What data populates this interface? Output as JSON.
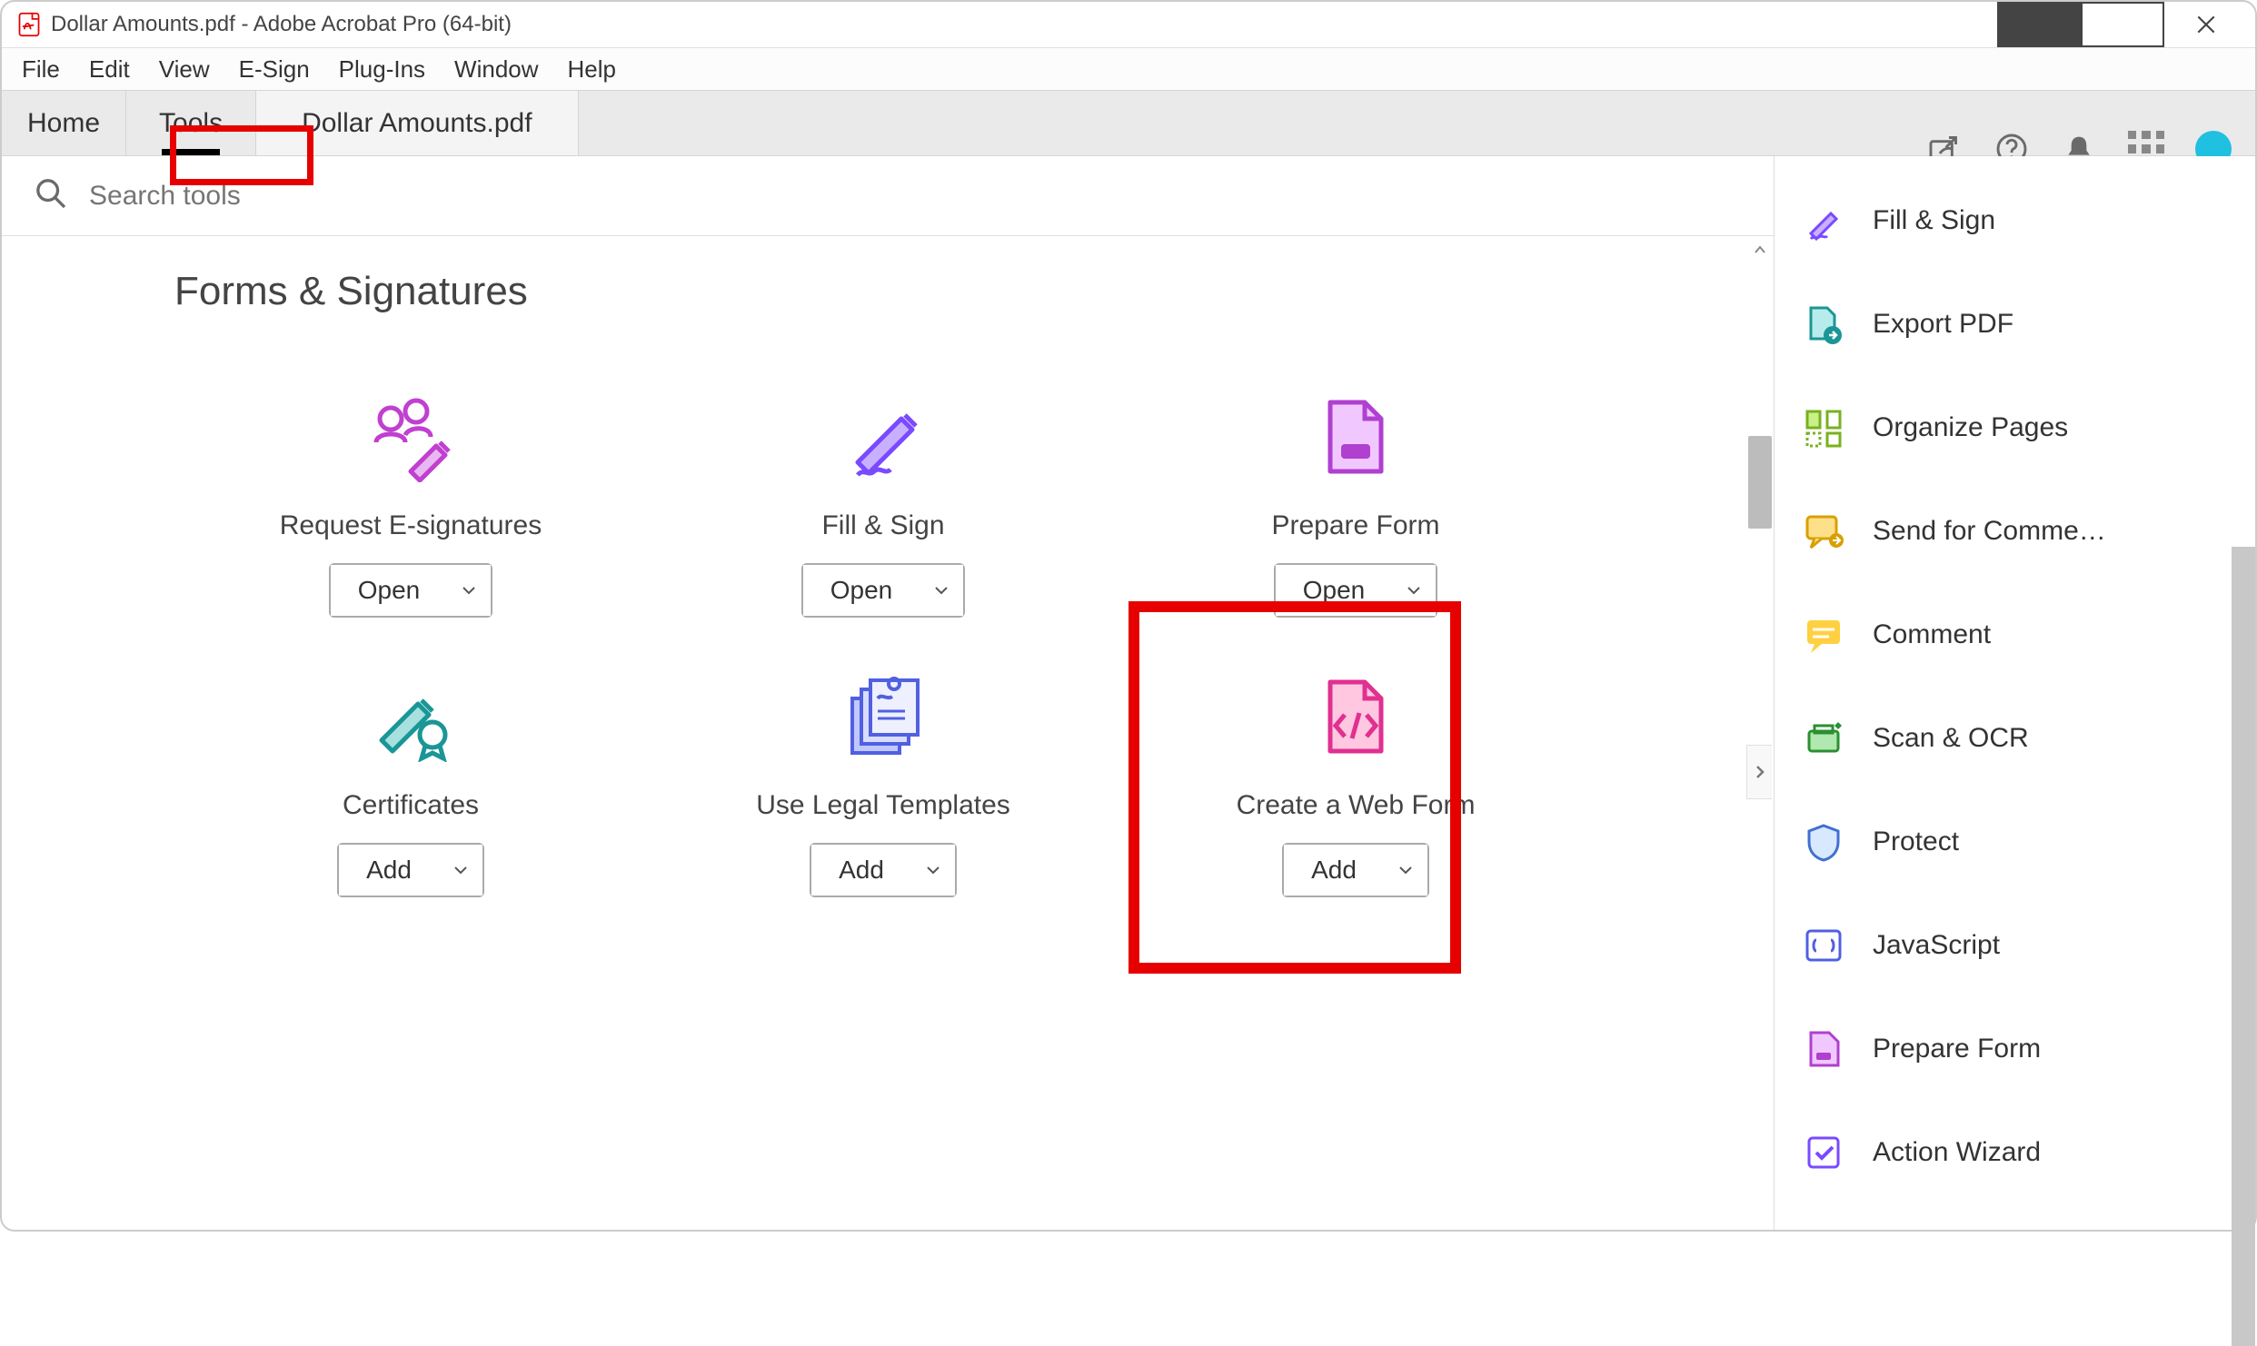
{
  "window": {
    "title": "Dollar Amounts.pdf - Adobe Acrobat Pro (64-bit)"
  },
  "menubar": [
    "File",
    "Edit",
    "View",
    "E-Sign",
    "Plug-Ins",
    "Window",
    "Help"
  ],
  "tabs": {
    "home": "Home",
    "tools": "Tools",
    "doc": "Dollar Amounts.pdf"
  },
  "search": {
    "placeholder": "Search tools"
  },
  "section": {
    "title": "Forms & Signatures"
  },
  "actions": {
    "open": "Open",
    "add": "Add"
  },
  "tools": {
    "request_esignatures": "Request E-signatures",
    "fill_sign": "Fill & Sign",
    "prepare_form": "Prepare Form",
    "certificates": "Certificates",
    "use_legal_templates": "Use Legal Templates",
    "create_web_form": "Create a Web Form"
  },
  "side": {
    "fill_sign": "Fill & Sign",
    "export_pdf": "Export PDF",
    "organize_pages": "Organize Pages",
    "send_for_comments": "Send for Comme…",
    "comment": "Comment",
    "scan_ocr": "Scan & OCR",
    "protect": "Protect",
    "javascript": "JavaScript",
    "prepare_form": "Prepare Form",
    "action_wizard": "Action Wizard"
  }
}
